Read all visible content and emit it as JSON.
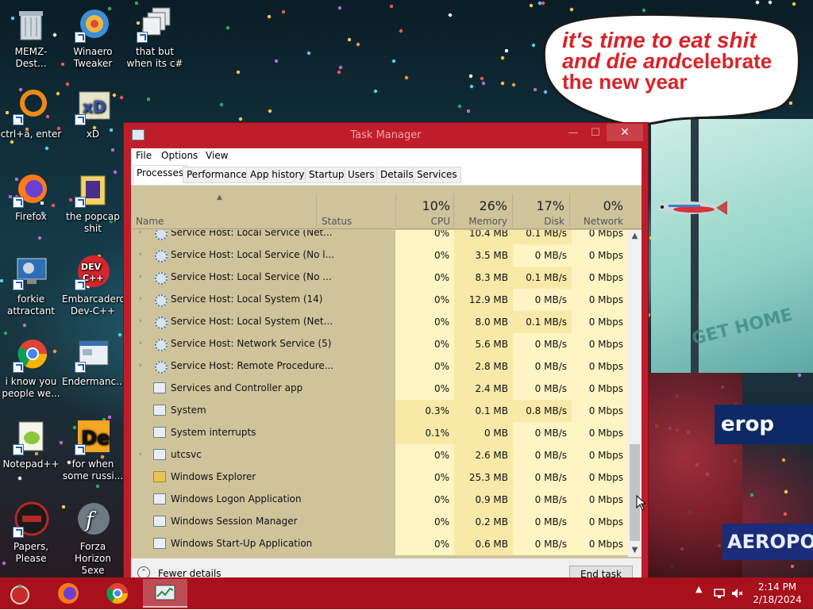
{
  "desktop": {
    "bubble": {
      "line1": "it's time to eat shit",
      "line2a": "and die and",
      "line2b": "celebrate",
      "line3": "the new year"
    },
    "billboards": {
      "get_home": "GET HOME",
      "banner1": "erop",
      "banner2": "AEROPOS"
    },
    "icons": [
      {
        "label": "MEMZ-Dest..."
      },
      {
        "label": "Winaero Tweaker"
      },
      {
        "label": "that but when its c#"
      },
      {
        "label": "ctrl+a, enter"
      },
      {
        "label": "xD"
      },
      {
        "label": "Firefox"
      },
      {
        "label": "the popcap shit"
      },
      {
        "label": "forkie attractant"
      },
      {
        "label": "Embarcadero Dev-C++"
      },
      {
        "label": "i know you people we..."
      },
      {
        "label": "Endermanc..."
      },
      {
        "label": "Notepad++"
      },
      {
        "label": "for when some russi..."
      },
      {
        "label": "Papers, Please"
      },
      {
        "label": "Forza Horizon 5exe"
      }
    ]
  },
  "window": {
    "title": "Task Manager",
    "close_glyph": "✕",
    "min_glyph": "—",
    "max_glyph": "☐",
    "menu": [
      "File",
      "Options",
      "View"
    ],
    "tabs": [
      "Processes",
      "Performance",
      "App history",
      "Startup",
      "Users",
      "Details",
      "Services"
    ],
    "columns": {
      "name": "Name",
      "status": "Status",
      "cpu": {
        "pct": "10%",
        "label": "CPU"
      },
      "memory": {
        "pct": "26%",
        "label": "Memory"
      },
      "disk": {
        "pct": "17%",
        "label": "Disk"
      },
      "network": {
        "pct": "0%",
        "label": "Network"
      }
    },
    "rows": [
      {
        "name": "Service Host: Local Service (Net...",
        "cpu": "0%",
        "mem": "10.4 MB",
        "disk": "0.1 MB/s",
        "net": "0 Mbps",
        "icon": "gear",
        "expand": true,
        "partial": true
      },
      {
        "name": "Service Host: Local Service (No l...",
        "cpu": "0%",
        "mem": "3.5 MB",
        "disk": "0 MB/s",
        "net": "0 Mbps",
        "icon": "gear",
        "expand": true
      },
      {
        "name": "Service Host: Local Service (No ...",
        "cpu": "0%",
        "mem": "8.3 MB",
        "disk": "0.1 MB/s",
        "net": "0 Mbps",
        "icon": "gear",
        "expand": true
      },
      {
        "name": "Service Host: Local System (14)",
        "cpu": "0%",
        "mem": "12.9 MB",
        "disk": "0 MB/s",
        "net": "0 Mbps",
        "icon": "gear",
        "expand": true
      },
      {
        "name": "Service Host: Local System (Net...",
        "cpu": "0%",
        "mem": "8.0 MB",
        "disk": "0.1 MB/s",
        "net": "0 Mbps",
        "icon": "gear",
        "expand": true
      },
      {
        "name": "Service Host: Network Service (5)",
        "cpu": "0%",
        "mem": "5.6 MB",
        "disk": "0 MB/s",
        "net": "0 Mbps",
        "icon": "gear",
        "expand": true
      },
      {
        "name": "Service Host: Remote Procedure...",
        "cpu": "0%",
        "mem": "2.8 MB",
        "disk": "0 MB/s",
        "net": "0 Mbps",
        "icon": "gear",
        "expand": true
      },
      {
        "name": "Services and Controller app",
        "cpu": "0%",
        "mem": "2.4 MB",
        "disk": "0 MB/s",
        "net": "0 Mbps",
        "icon": "app",
        "expand": false
      },
      {
        "name": "System",
        "cpu": "0.3%",
        "mem": "0.1 MB",
        "disk": "0.8 MB/s",
        "net": "0 Mbps",
        "icon": "app",
        "expand": false
      },
      {
        "name": "System interrupts",
        "cpu": "0.1%",
        "mem": "0 MB",
        "disk": "0 MB/s",
        "net": "0 Mbps",
        "icon": "app",
        "expand": false
      },
      {
        "name": "utcsvc",
        "cpu": "0%",
        "mem": "2.6 MB",
        "disk": "0 MB/s",
        "net": "0 Mbps",
        "icon": "app",
        "expand": true
      },
      {
        "name": "Windows Explorer",
        "cpu": "0%",
        "mem": "25.3 MB",
        "disk": "0 MB/s",
        "net": "0 Mbps",
        "icon": "folder",
        "expand": false
      },
      {
        "name": "Windows Logon Application",
        "cpu": "0%",
        "mem": "0.9 MB",
        "disk": "0 MB/s",
        "net": "0 Mbps",
        "icon": "app",
        "expand": false
      },
      {
        "name": "Windows Session Manager",
        "cpu": "0%",
        "mem": "0.2 MB",
        "disk": "0 MB/s",
        "net": "0 Mbps",
        "icon": "app",
        "expand": false
      },
      {
        "name": "Windows Start-Up Application",
        "cpu": "0%",
        "mem": "0.6 MB",
        "disk": "0 MB/s",
        "net": "0 Mbps",
        "icon": "app",
        "expand": false
      }
    ],
    "footer": {
      "fewer_details": "Fewer details",
      "end_task": "End task"
    }
  },
  "taskbar": {
    "time": "2:14 PM",
    "date": "2/18/2024",
    "color": "#a8101c"
  },
  "colors": {
    "window_frame": "#c01d2a",
    "table_bg": "#cfc39c",
    "cell_highlight_light": "#fff4c4",
    "cell_highlight_mid": "#f8e9a8",
    "bubble_text": "#d8232a"
  }
}
